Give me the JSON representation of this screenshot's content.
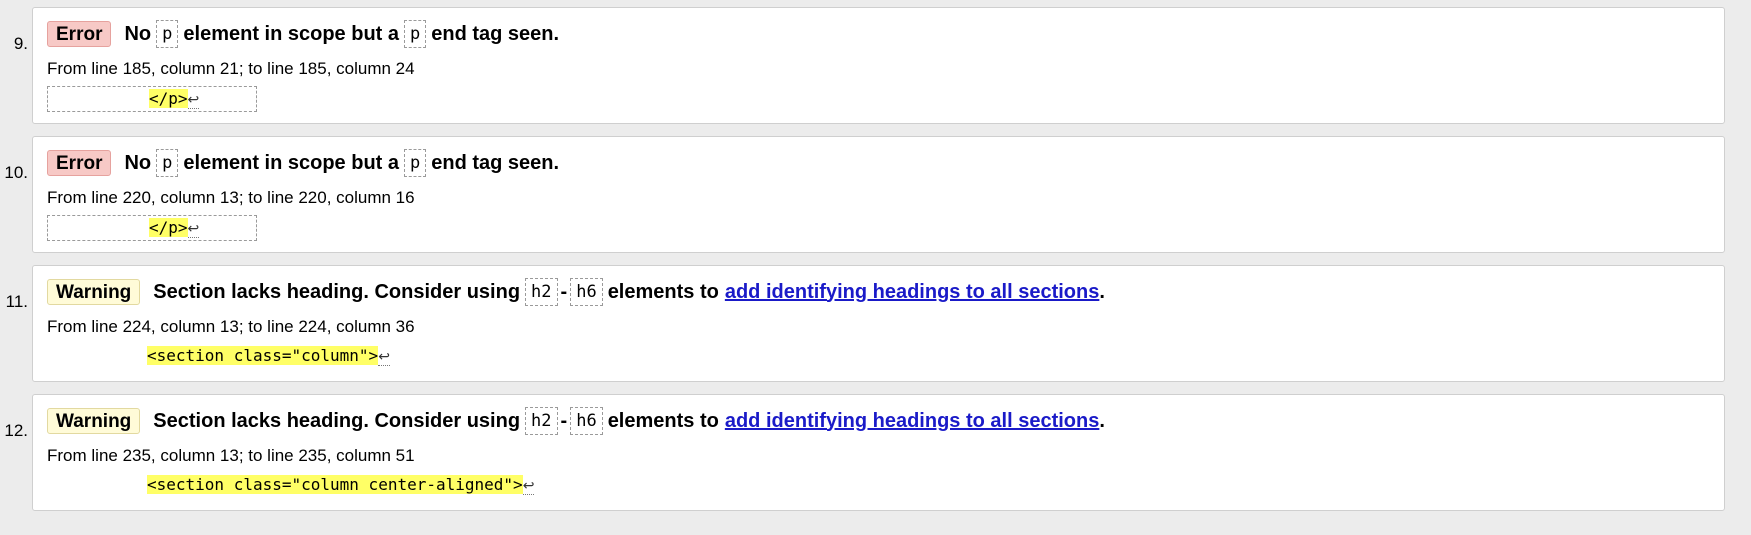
{
  "messages": [
    {
      "number": "9.",
      "type_label": "Error",
      "text_before": "No",
      "code1": "p",
      "text_middle": "element in scope but a",
      "code2": "p",
      "text_after": "end tag seen.",
      "location": "From line 185, column 21; to line 185, column 24",
      "extract": "</p>",
      "return_glyph": "↩"
    },
    {
      "number": "10.",
      "type_label": "Error",
      "text_before": "No",
      "code1": "p",
      "text_middle": "element in scope but a",
      "code2": "p",
      "text_after": "end tag seen.",
      "location": "From line 220, column 13; to line 220, column 16",
      "extract": "</p>",
      "return_glyph": "↩"
    },
    {
      "number": "11.",
      "type_label": "Warning",
      "text_before": "Section lacks heading. Consider using",
      "code1": "h2",
      "separator": "-",
      "code2": "h6",
      "text_after": "elements to",
      "link": "add identifying headings to all sections",
      "trailing": ".",
      "location": "From line 224, column 13; to line 224, column 36",
      "extract": "<section class=\"column\">",
      "return_glyph": "↩"
    },
    {
      "number": "12.",
      "type_label": "Warning",
      "text_before": "Section lacks heading. Consider using",
      "code1": "h2",
      "separator": "-",
      "code2": "h6",
      "text_after": "elements to",
      "link": "add identifying headings to all sections",
      "trailing": ".",
      "location": "From line 235, column 13; to line 235, column 51",
      "extract": "<section class=\"column center-aligned\">",
      "return_glyph": "↩"
    }
  ],
  "colors": {
    "error_badge": "#f7c9c6",
    "warning_badge": "#fffbd8",
    "highlight": "#ffff66",
    "link": "#1a1ac8",
    "page_background": "#ececec"
  }
}
